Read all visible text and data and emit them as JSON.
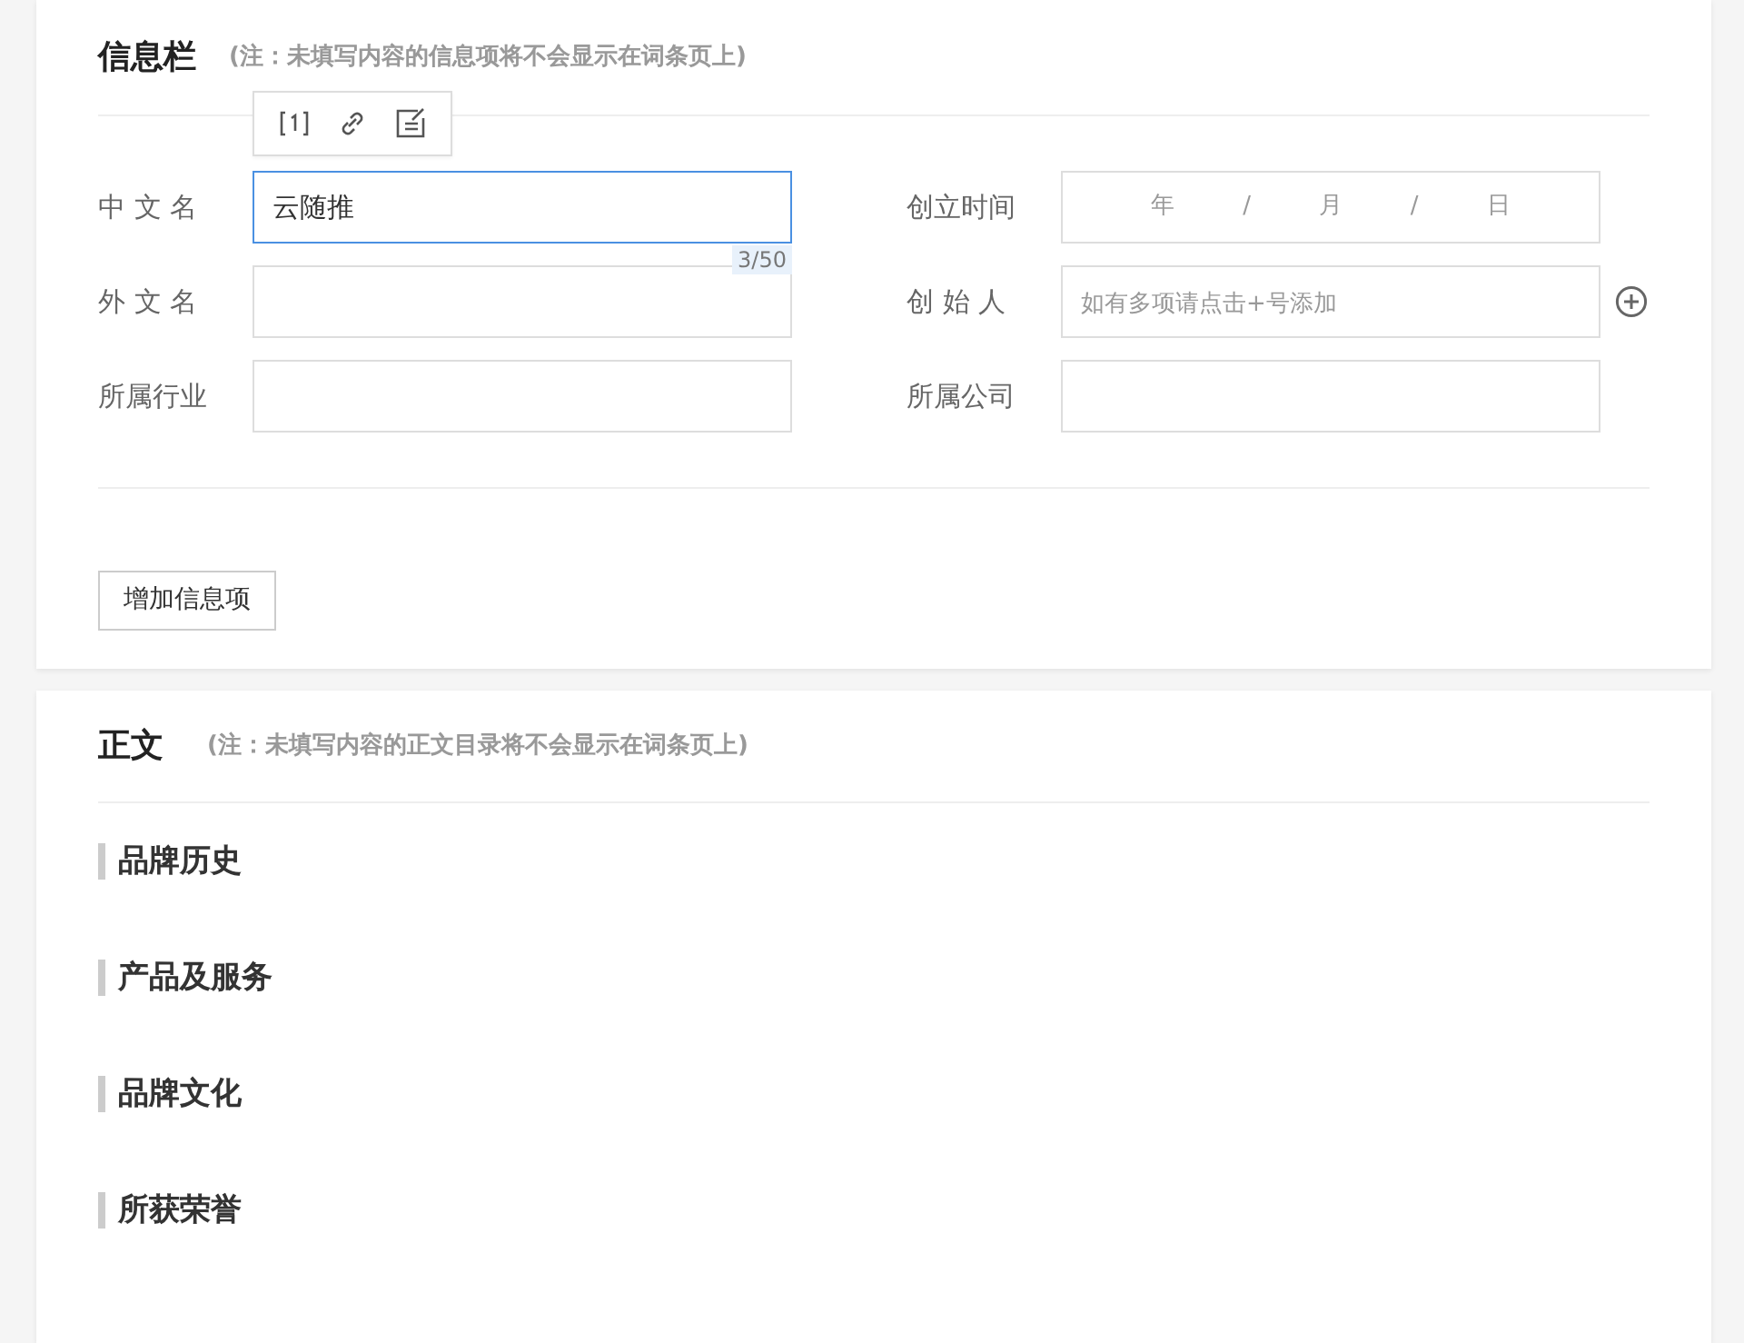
{
  "info_panel": {
    "title": "信息栏",
    "note": "(注：未填写内容的信息项将不会显示在词条页上)",
    "rows": [
      [
        {
          "kind": "text",
          "label": "中 文 名",
          "value": "云随推",
          "focused": true,
          "counter": "3/50",
          "toolbar": true
        },
        {
          "kind": "date",
          "label": "创立时间",
          "parts": [
            "年",
            "/",
            "月",
            "/",
            "日"
          ]
        }
      ],
      [
        {
          "kind": "text",
          "label": "外 文 名",
          "focused": false
        },
        {
          "kind": "text",
          "label": "创 始 人",
          "placeholder": "如有多项请点击+号添加",
          "focused": false,
          "add_button": true
        }
      ],
      [
        {
          "kind": "text",
          "label": "所属行业",
          "focused": false
        },
        {
          "kind": "text",
          "label": "所属公司",
          "focused": false
        }
      ]
    ],
    "add_item_button": "增加信息项"
  },
  "body_panel": {
    "title": "正文",
    "note": "(注：未填写内容的正文目录将不会显示在词条页上)",
    "headings": [
      "品牌历史",
      "产品及服务",
      "品牌文化",
      "所获荣誉"
    ]
  }
}
